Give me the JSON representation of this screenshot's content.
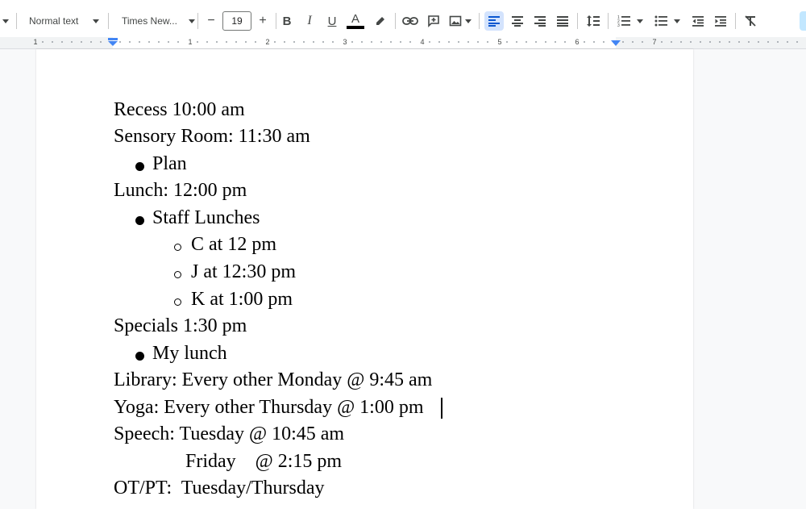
{
  "toolbar": {
    "style_select": "Normal text",
    "font_select": "Times New...",
    "font_size": "19",
    "minus": "−",
    "plus": "+",
    "bold": "B",
    "italic": "I",
    "underline": "U",
    "text_color_letter": "A"
  },
  "ruler": {
    "numbers": [
      "1",
      "1",
      "2",
      "3",
      "4",
      "5",
      "6",
      "7"
    ]
  },
  "document": {
    "lines": [
      "Recess 10:00 am",
      "Sensory Room: 11:30 am",
      "Plan",
      "Lunch: 12:00 pm",
      "Staff Lunches",
      "C at 12 pm",
      "J at 12:30 pm",
      "K at 1:00 pm",
      "Specials 1:30 pm",
      "My lunch",
      "Library: Every other Monday @ 9:45 am",
      "Yoga: Every other Thursday @ 1:00 pm",
      "Speech: Tuesday @ 10:45 am",
      "Friday    @ 2:15 pm",
      "OT/PT:  Tuesday/Thursday"
    ]
  }
}
